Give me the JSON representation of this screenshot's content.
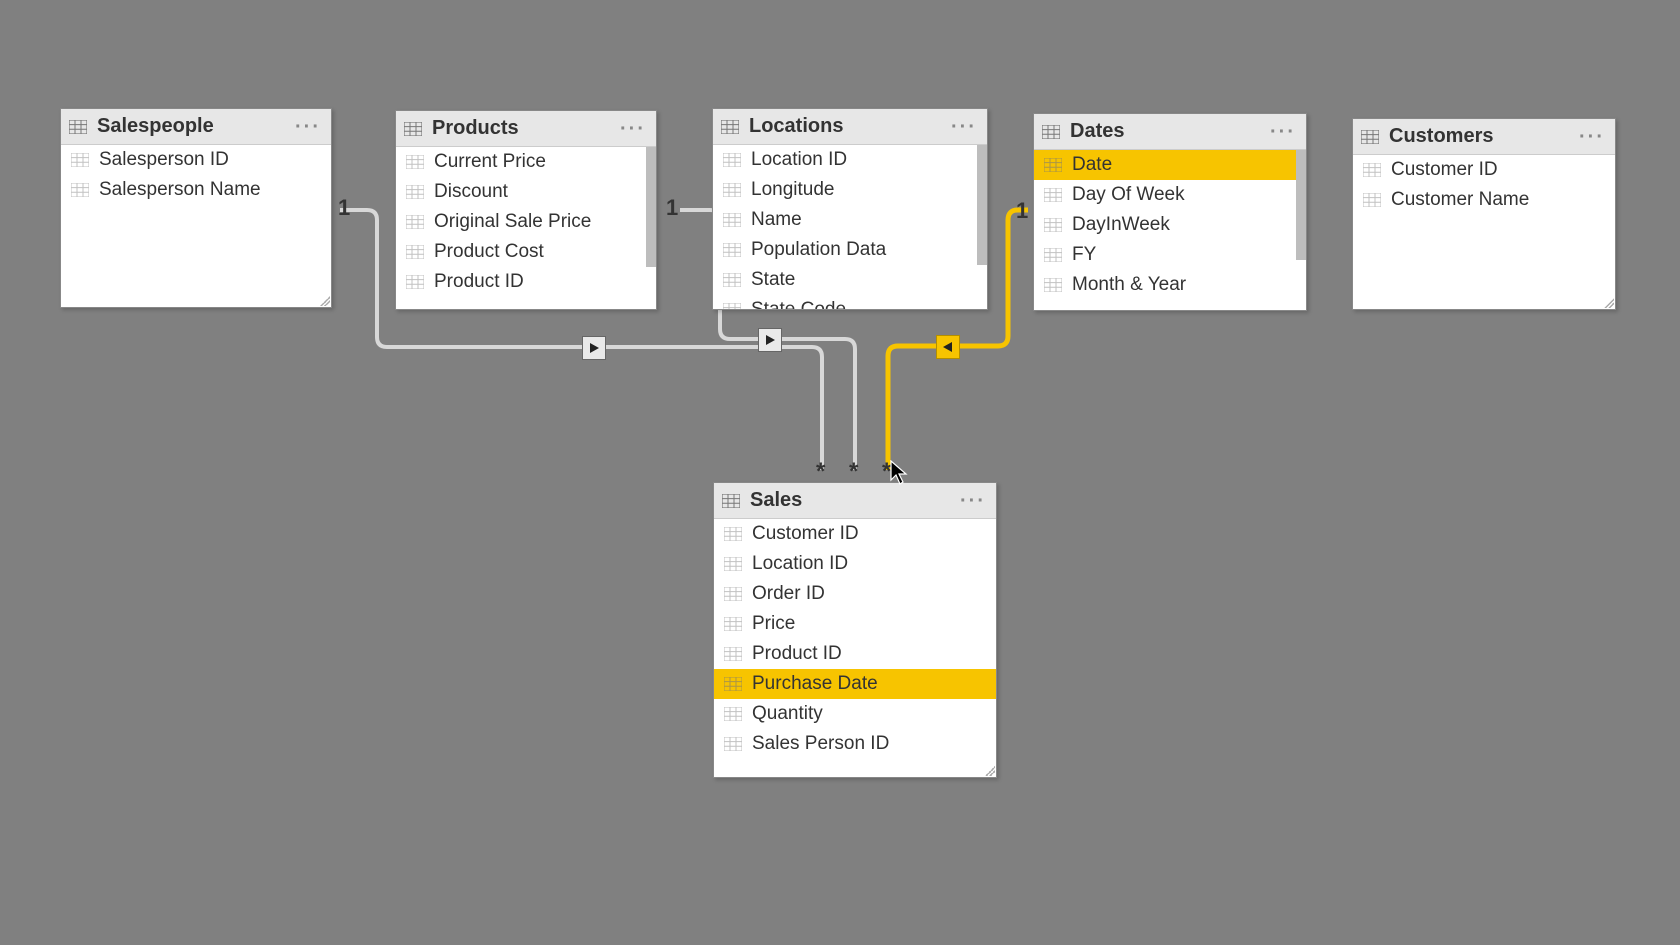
{
  "tables": {
    "salespeople": {
      "title": "Salespeople",
      "fields": [
        "Salesperson ID",
        "Salesperson Name"
      ]
    },
    "products": {
      "title": "Products",
      "fields": [
        "Current Price",
        "Discount",
        "Original Sale Price",
        "Product Cost",
        "Product ID"
      ]
    },
    "locations": {
      "title": "Locations",
      "fields": [
        "Location ID",
        "Longitude",
        "Name",
        "Population Data",
        "State",
        "State Code"
      ]
    },
    "dates": {
      "title": "Dates",
      "fields": [
        "Date",
        "Day Of Week",
        "DayInWeek",
        "FY",
        "Month & Year"
      ],
      "highlight_index": 0
    },
    "customers": {
      "title": "Customers",
      "fields": [
        "Customer ID",
        "Customer Name"
      ]
    },
    "sales": {
      "title": "Sales",
      "fields": [
        "Customer ID",
        "Location ID",
        "Order ID",
        "Price",
        "Product ID",
        "Purchase Date",
        "Quantity",
        "Sales Person ID"
      ],
      "highlight_index": 5
    }
  },
  "cardinality": {
    "one": "1",
    "many": "*"
  },
  "relationships": [
    {
      "from": "salespeople",
      "to": "sales",
      "type": "one-to-many"
    },
    {
      "from": "products",
      "to": "sales",
      "type": "one-to-many"
    },
    {
      "from": "locations",
      "to": "sales",
      "type": "one-to-many"
    },
    {
      "from": "dates",
      "to": "sales",
      "type": "one-to-many",
      "active": true,
      "highlighted": true
    }
  ],
  "colors": {
    "highlight": "#f7c400",
    "line_default": "#d0d0d0",
    "line_active": "#f7c400"
  }
}
